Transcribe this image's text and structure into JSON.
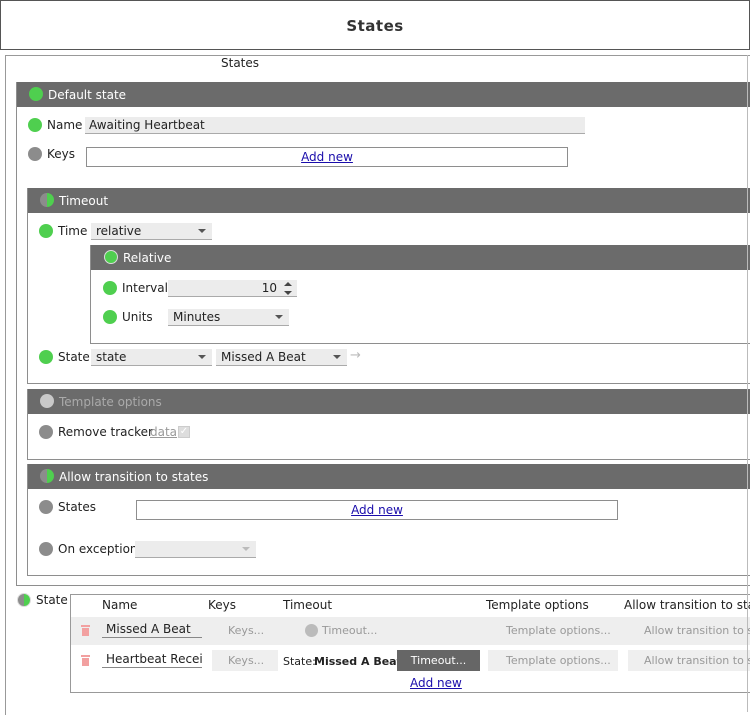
{
  "header": {
    "title": "States"
  },
  "states_label": "States",
  "default_state": {
    "title": "Default state",
    "name_label": "Name",
    "name_value": "Awaiting Heartbeat",
    "keys_label": "Keys",
    "keys_add": "Add new",
    "timeout": {
      "title": "Timeout",
      "time_label": "Time",
      "time_value": "relative",
      "relative": {
        "title": "Relative",
        "interval_label": "Interval",
        "interval_value": "10",
        "units_label": "Units",
        "units_value": "Minutes"
      },
      "state_label": "State",
      "state_type": "state",
      "state_target": "Missed A Beat",
      "arrow": "→"
    },
    "template_options": {
      "title": "Template options",
      "remove_tracker_label": "Remove tracker",
      "data_link": "data"
    },
    "allow_transition": {
      "title": "Allow transition to states",
      "states_label": "States",
      "states_add": "Add new",
      "on_exception_label": "On exception",
      "on_exception_value": ""
    }
  },
  "state_table": {
    "label": "State",
    "columns": [
      "Name",
      "Keys",
      "Timeout",
      "Template options",
      "Allow transition to sta"
    ],
    "rows": [
      {
        "name": "Missed A Beat",
        "keys": "Keys...",
        "timeout": "Timeout...",
        "template": "Template options...",
        "allow": "Allow transition to st"
      },
      {
        "name": "Heartbeat Recei",
        "keys": "Keys...",
        "timeout_prefix": "State:",
        "timeout_state": "Missed A Beat",
        "timeout_btn": "Timeout...",
        "template": "Template options...",
        "allow": "Allow transition to st"
      }
    ],
    "add_new": "Add new"
  },
  "colors": {
    "accent_green": "#4fcf4f",
    "bar_gray": "#6b6b6b",
    "dot_gray": "#8c8c8c"
  }
}
